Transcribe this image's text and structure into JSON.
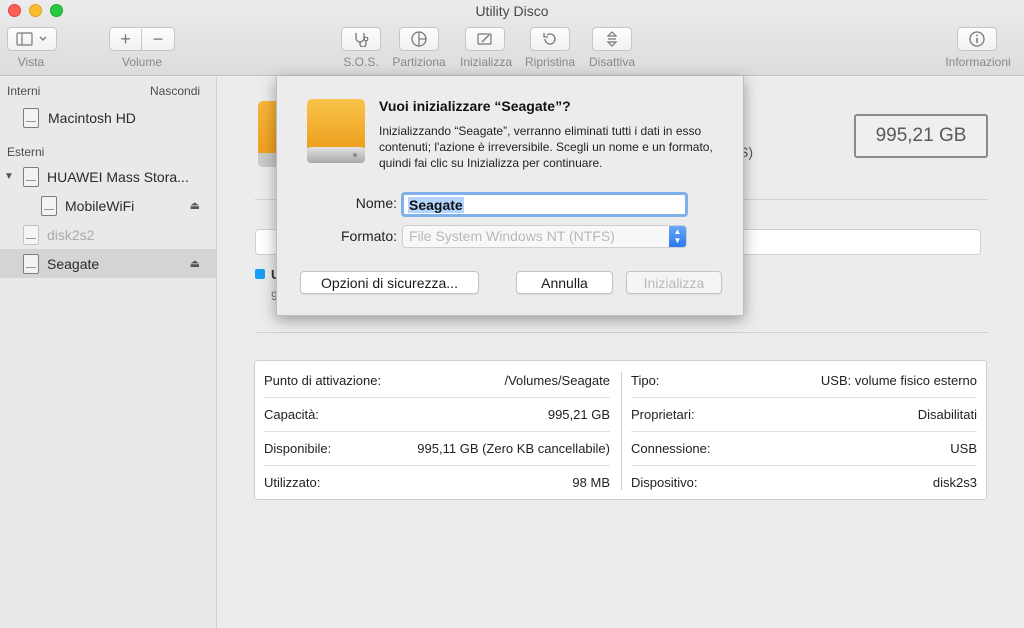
{
  "window": {
    "title": "Utility Disco"
  },
  "toolbar": {
    "vista": "Vista",
    "volume": "Volume",
    "sos": "S.O.S.",
    "partiziona": "Partiziona",
    "inizializza": "Inizializza",
    "ripristina": "Ripristina",
    "disattiva": "Disattiva",
    "informazioni": "Informazioni"
  },
  "sidebar": {
    "interni_header": "Interni",
    "nascondi": "Nascondi",
    "esterni_header": "Esterni",
    "items": [
      {
        "label": "Macintosh HD"
      },
      {
        "label": "HUAWEI Mass Stora..."
      },
      {
        "label": "MobileWiFi"
      },
      {
        "label": "disk2s2"
      },
      {
        "label": "Seagate"
      }
    ]
  },
  "main": {
    "capacity_box": "995,21 GB",
    "partial_s": "S)",
    "partial_u": "U",
    "partial_9": "9",
    "info": {
      "left": [
        {
          "key": "Punto di attivazione:",
          "value": "/Volumes/Seagate"
        },
        {
          "key": "Capacità:",
          "value": "995,21 GB"
        },
        {
          "key": "Disponibile:",
          "value": "995,11 GB (Zero KB cancellabile)"
        },
        {
          "key": "Utilizzato:",
          "value": "98 MB"
        }
      ],
      "right": [
        {
          "key": "Tipo:",
          "value": "USB: volume fisico esterno"
        },
        {
          "key": "Proprietari:",
          "value": "Disabilitati"
        },
        {
          "key": "Connessione:",
          "value": "USB"
        },
        {
          "key": "Dispositivo:",
          "value": "disk2s3"
        }
      ]
    }
  },
  "dialog": {
    "title": "Vuoi inizializzare “Seagate”?",
    "message": "Inizializzando “Seagate”, verranno eliminati tutti i dati in esso contenuti; l'azione è irreversibile. Scegli un nome e un formato, quindi fai clic su Inizializza per continuare.",
    "name_label": "Nome:",
    "name_value": "Seagate",
    "format_label": "Formato:",
    "format_value": "File System Windows NT (NTFS)",
    "security_button": "Opzioni di sicurezza...",
    "cancel_button": "Annulla",
    "erase_button": "Inizializza"
  },
  "colors": {
    "accent": "#2a78f0",
    "drive_orange": "#f2a72a",
    "selection": "#b3d4fd"
  }
}
